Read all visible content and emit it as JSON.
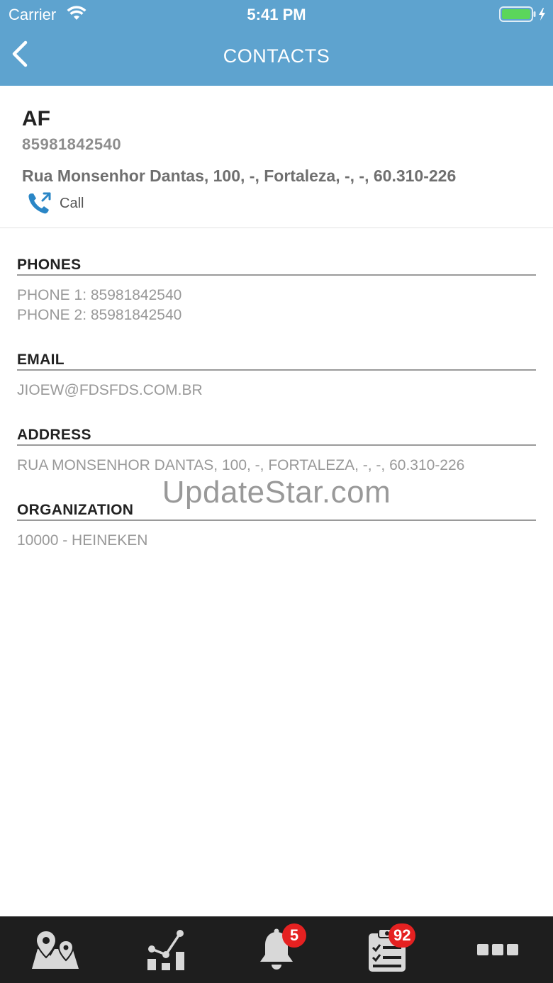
{
  "status_bar": {
    "carrier": "Carrier",
    "time": "5:41 PM"
  },
  "nav": {
    "title": "CONTACTS"
  },
  "contact": {
    "name": "AF",
    "phone": "85981842540",
    "address": "Rua Monsenhor Dantas, 100, -, Fortaleza, -, -, 60.310-226",
    "call_label": "Call"
  },
  "sections": {
    "phones": {
      "heading": "PHONES",
      "values": [
        "PHONE 1: 85981842540",
        "PHONE 2: 85981842540"
      ]
    },
    "email": {
      "heading": "EMAIL",
      "value": "JIOEW@FDSFDS.COM.BR"
    },
    "address": {
      "heading": "ADDRESS",
      "value": "RUA MONSENHOR DANTAS, 100, -, FORTALEZA, -, -, 60.310-226"
    },
    "organization": {
      "heading": "ORGANIZATION",
      "value": "10000 - HEINEKEN"
    }
  },
  "watermark": "UpdateStar.com",
  "tabbar": {
    "tabs": [
      {
        "icon": "map-pin-icon"
      },
      {
        "icon": "chart-icon"
      },
      {
        "icon": "bell-icon",
        "badge": "5"
      },
      {
        "icon": "clipboard-icon",
        "badge": "92"
      },
      {
        "icon": "more-icon"
      }
    ]
  },
  "colors": {
    "header": "#5ea3cf",
    "tabbar": "#1e1e1e",
    "badge": "#e52121",
    "call_icon": "#2a86c6"
  }
}
